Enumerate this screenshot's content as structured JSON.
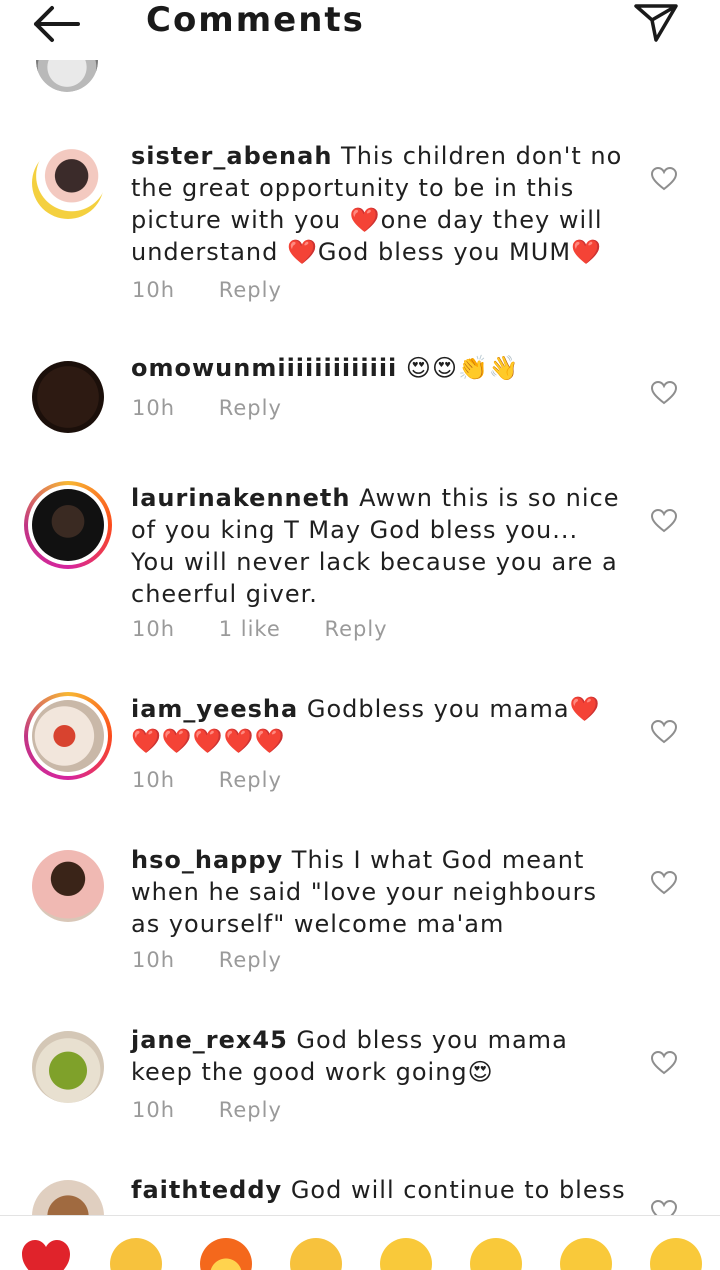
{
  "header": {
    "title": "Comments",
    "back_icon": "arrow-left-icon",
    "share_icon": "paper-plane-icon"
  },
  "comments": [
    {
      "username": "sister_abenah",
      "text": "This children don't no the great opportunity to be in this picture with you ❤️one day they will understand ❤️God bless you MUM❤️",
      "time": "10h",
      "reply": "Reply"
    },
    {
      "username": "omowunmiiiiiiiiiiiii",
      "text": "😍😍👏👋",
      "time": "10h",
      "reply": "Reply"
    },
    {
      "username": "laurinakenneth",
      "text": "Awwn this is so nice of you king T May God bless you... You will never lack because you are a cheerful giver.",
      "time": "10h",
      "likes": "1 like",
      "reply": "Reply"
    },
    {
      "username": "iam_yeesha",
      "text": "Godbless you mama❤️❤️❤️❤️❤️❤️",
      "time": "10h",
      "reply": "Reply"
    },
    {
      "username": "hso_happy",
      "text": "This I what God meant when he said \"love your neighbours as yourself\" welcome ma'am",
      "time": "10h",
      "reply": "Reply"
    },
    {
      "username": "jane_rex45",
      "text": "God bless you mama keep the good work going😍",
      "time": "10h",
      "reply": "Reply"
    },
    {
      "username": "faithteddy",
      "text": "God will continue to bless",
      "time": "",
      "reply": ""
    }
  ],
  "emoji_bar": [
    "heart",
    "raising-hands",
    "fire",
    "clapping-hands",
    "crying-face",
    "heart-eyes-face",
    "surprised-face",
    "tears-of-joy-face"
  ]
}
